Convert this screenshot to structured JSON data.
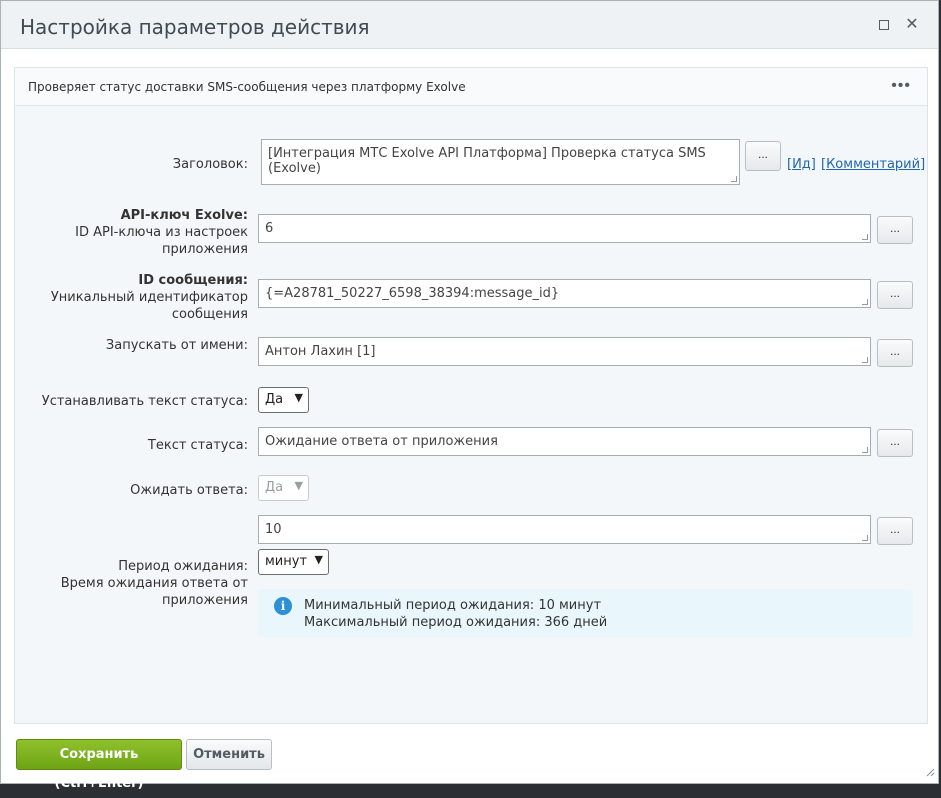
{
  "dialog": {
    "title": "Настройка параметров действия",
    "description": "Проверяет статус доставки SMS-сообщения через платформу Exolve",
    "menu_icon": "more-dots-icon"
  },
  "fields": {
    "title_label": "Заголовок:",
    "title_value": "[Интеграция МТС Exolve API Платформа] Проверка статуса SMS (Exolve)",
    "id_link": "Ид",
    "comment_link": "Комментарий",
    "api_key_label": "API-ключ Exolve:",
    "api_key_hint_1": "ID API-ключа из настроек",
    "api_key_hint_2": "приложения",
    "api_key_value": "6",
    "message_id_label": "ID сообщения:",
    "message_id_hint_1": "Уникальный идентификатор",
    "message_id_hint_2": "сообщения",
    "message_id_value": "{=A28781_50227_6598_38394:message_id}",
    "run_as_label": "Запускать от имени:",
    "run_as_value": "Антон Лахин [1]",
    "set_status_label": "Устанавливать текст статуса:",
    "set_status_value": "Да",
    "status_text_label": "Текст статуса:",
    "status_text_value": "Ожидание ответа от приложения",
    "wait_label": "Ожидать ответа:",
    "wait_value": "Да",
    "period_value": "10",
    "period_unit": "минут",
    "period_label": "Период ожидания:",
    "period_hint_1": "Время ожидания ответа от",
    "period_hint_2": "приложения",
    "dots_label": "..."
  },
  "info": {
    "line1": "Минимальный период ожидания: 10 минут",
    "line2": "Максимальный период ожидания: 366 дней"
  },
  "footer": {
    "save_label": "Сохранить (Ctrl+Enter)",
    "cancel_label": "Отменить"
  },
  "colors": {
    "save_button": "#7cb11f",
    "link": "#2067b0",
    "info_bg": "#e9f7fd"
  }
}
